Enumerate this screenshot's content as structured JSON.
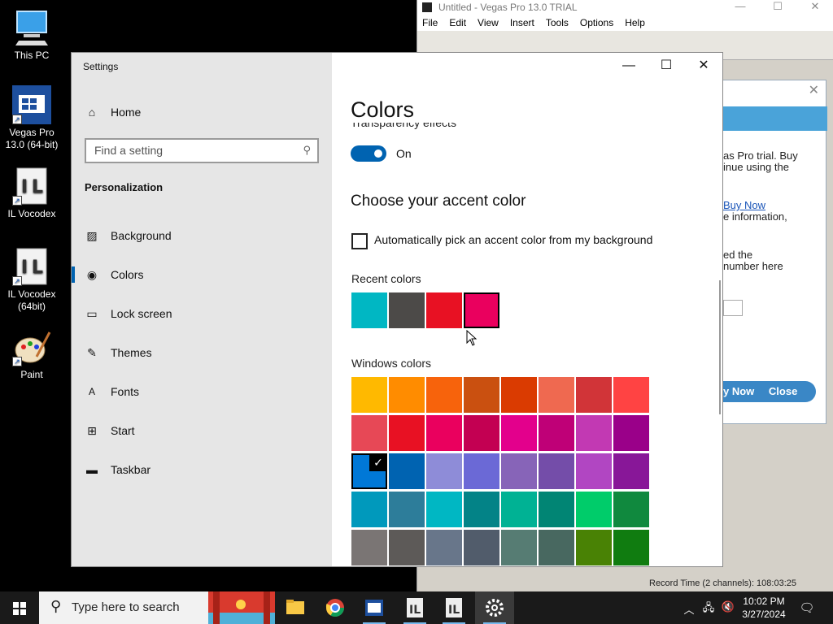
{
  "desktop": {
    "icons": [
      {
        "label1": "This PC",
        "label2": ""
      },
      {
        "label1": "Vegas Pro",
        "label2": "13.0 (64-bit)"
      },
      {
        "label1": "IL Vocodex",
        "label2": ""
      },
      {
        "label1": "IL Vocodex",
        "label2": "(64bit)"
      },
      {
        "label1": "Paint",
        "label2": ""
      }
    ]
  },
  "vegas": {
    "title": "Untitled - Vegas Pro 13.0 TRIAL",
    "menu": [
      "File",
      "Edit",
      "View",
      "Insert",
      "Tools",
      "Options",
      "Help"
    ],
    "dialog": {
      "line1": "as Pro trial. Buy",
      "line2": "inue using the",
      "link": "Buy Now",
      "line3": "e information,",
      "line4": "ed the",
      "line5": "number here",
      "buy_label": "y Now",
      "close_label": "Close"
    },
    "status": "Record Time (2 channels): 108:03:25"
  },
  "settings": {
    "window_title": "Settings",
    "nav": {
      "home": "Home",
      "search_placeholder": "Find a setting",
      "section": "Personalization",
      "items": [
        "Background",
        "Colors",
        "Lock screen",
        "Themes",
        "Fonts",
        "Start",
        "Taskbar"
      ]
    },
    "content": {
      "title": "Colors",
      "transparency_label": "Transparency effects",
      "toggle_state": "On",
      "accent_heading": "Choose your accent color",
      "auto_pick_label": "Automatically pick an accent color from my background",
      "recent_label": "Recent colors",
      "recent_colors": [
        "#00b7c3",
        "#4c4a48",
        "#e81123",
        "#ea005e"
      ],
      "windows_label": "Windows colors",
      "windows_colors": [
        [
          "#ffb900",
          "#ff8c00",
          "#f7630c",
          "#ca5010",
          "#da3b01",
          "#ef6950",
          "#d13438",
          "#ff4343"
        ],
        [
          "#e74856",
          "#e81123",
          "#ea005e",
          "#c30052",
          "#e3008c",
          "#bf0077",
          "#c239b3",
          "#9a0089"
        ],
        [
          "#0078d7",
          "#0063b1",
          "#8e8cd8",
          "#6b69d6",
          "#8764b8",
          "#744da9",
          "#b146c2",
          "#881798"
        ],
        [
          "#0099bc",
          "#2d7d9a",
          "#00b7c3",
          "#038387",
          "#00b294",
          "#018574",
          "#00cc6a",
          "#10893e"
        ],
        [
          "#7a7574",
          "#5d5a58",
          "#68768a",
          "#515c6b",
          "#567c73",
          "#486860",
          "#498205",
          "#107c10"
        ]
      ]
    }
  },
  "taskbar": {
    "search_placeholder": "Type here to search",
    "time": "10:02 PM",
    "date": "3/27/2024"
  }
}
